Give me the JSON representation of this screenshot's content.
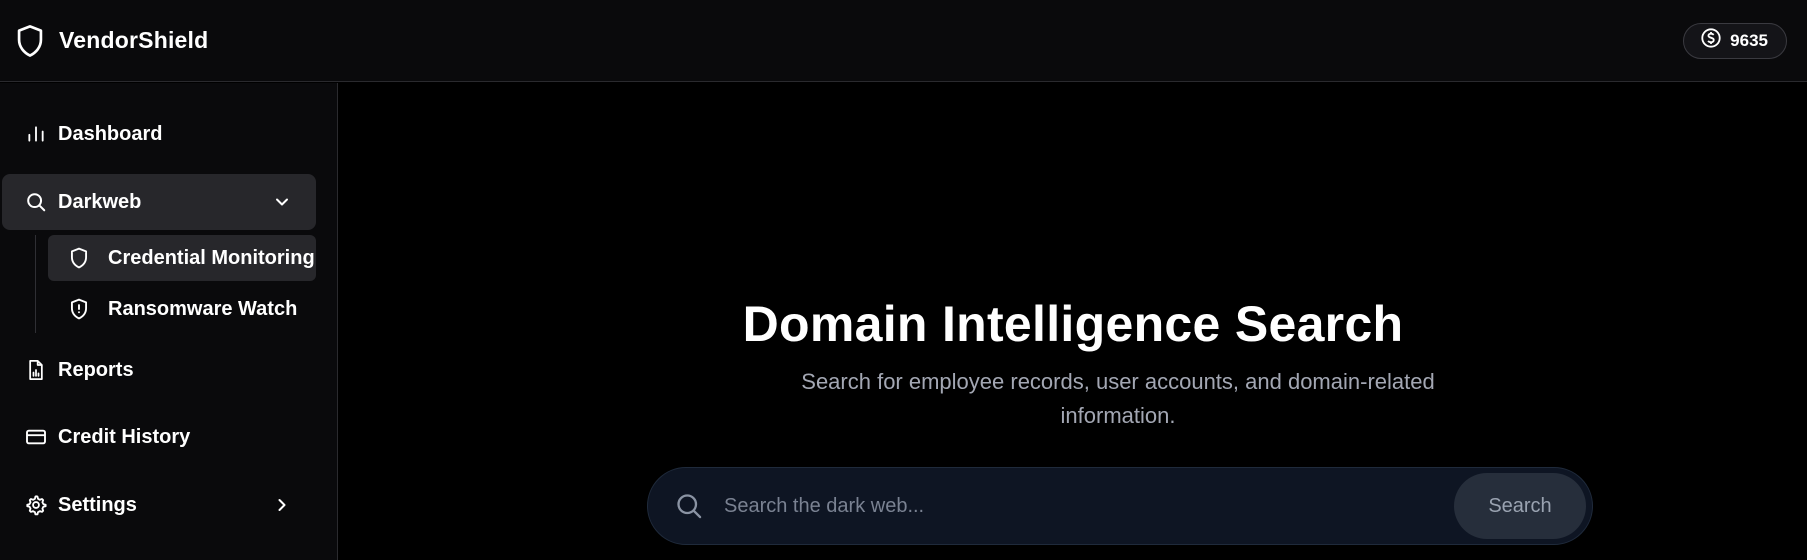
{
  "app": {
    "name": "VendorShield",
    "credits": "9635"
  },
  "sidebar": {
    "items": [
      {
        "label": "Dashboard"
      },
      {
        "label": "Darkweb"
      },
      {
        "label": "Reports"
      },
      {
        "label": "Credit History"
      },
      {
        "label": "Settings"
      }
    ],
    "darkweb_sub": [
      {
        "label": "Credential Monitoring"
      },
      {
        "label": "Ransomware Watch"
      }
    ]
  },
  "main": {
    "title": "Domain Intelligence Search",
    "subtitle": "Search for employee records, user accounts, and domain-related information.",
    "search": {
      "placeholder": "Search the dark web...",
      "value": "",
      "button_label": "Search"
    }
  },
  "colors": {
    "background": "#000000",
    "panel": "#0a0a0c",
    "active_item": "#27272b",
    "search_bg": "#0e1523",
    "search_button": "#262e3b",
    "muted_text": "#a3a7b3"
  }
}
